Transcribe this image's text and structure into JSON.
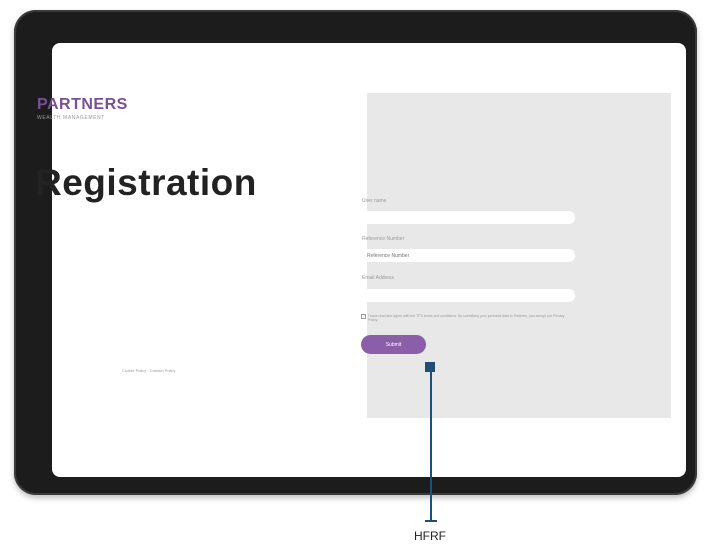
{
  "brand": {
    "name": "PARTNERS",
    "tagline": "WEALTH MANAGEMENT"
  },
  "page_title": "Registration",
  "footer": {
    "links": "Cookie Policy · Contact Policy"
  },
  "form": {
    "fields": [
      {
        "label": "User name",
        "value": "",
        "placeholder": ""
      },
      {
        "label": "Reference Number",
        "value": "",
        "placeholder": "Reference Number"
      },
      {
        "label": "Email Address",
        "value": "",
        "placeholder": ""
      }
    ],
    "consent_text": "I have read and agree with the TFS terms and conditions. By submitting your personal data to Partners, you accept our Privacy Policy.",
    "submit_label": "Submit"
  },
  "callout": {
    "label": "HFRF"
  },
  "colors": {
    "brand": "#7a4f96",
    "button": "#8a5ea8",
    "callout": "#1f4e79",
    "panel": "#e8e8e8"
  }
}
